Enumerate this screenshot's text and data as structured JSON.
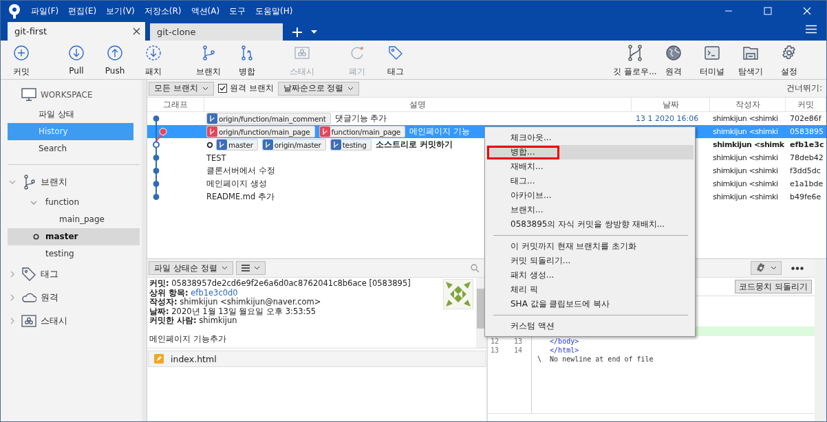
{
  "window": {
    "menu": [
      "파일(F)",
      "편집(E)",
      "보기(V)",
      "저장소(R)",
      "액션(A)",
      "도구",
      "도움말(H)"
    ]
  },
  "tabs": [
    {
      "label": "git-first",
      "selected": true
    },
    {
      "label": "git-clone",
      "selected": false
    }
  ],
  "toolbar": {
    "left_groups": [
      [
        {
          "label": "커밋",
          "kind": "commit",
          "disabled": false
        }
      ],
      [
        {
          "label": "Pull",
          "kind": "pull",
          "disabled": false
        },
        {
          "label": "Push",
          "kind": "push",
          "disabled": false
        },
        {
          "label": "패치",
          "kind": "fetch",
          "disabled": false
        }
      ],
      [
        {
          "label": "브랜치",
          "kind": "branch",
          "disabled": false
        },
        {
          "label": "병합",
          "kind": "merge",
          "disabled": false
        }
      ],
      [
        {
          "label": "스태시",
          "kind": "stash",
          "disabled": true
        }
      ],
      [
        {
          "label": "폐기",
          "kind": "discard",
          "disabled": true
        },
        {
          "label": "태그",
          "kind": "tag",
          "disabled": false
        }
      ]
    ],
    "right": [
      {
        "label": "깃 플로우...",
        "kind": "flow",
        "disabled": false
      },
      {
        "label": "원격",
        "kind": "globe",
        "disabled": false
      },
      {
        "label": "터미널",
        "kind": "terminal",
        "disabled": false
      },
      {
        "label": "탐색기",
        "kind": "folder",
        "disabled": false
      },
      {
        "label": "설정",
        "kind": "gear",
        "disabled": false
      }
    ]
  },
  "sidebar": {
    "workspace": {
      "title": "WORKSPACE",
      "items": [
        {
          "label": "파일 상태",
          "selected": false
        },
        {
          "label": "History",
          "selected": true
        },
        {
          "label": "Search",
          "selected": false
        }
      ]
    },
    "sections": [
      {
        "label": "브랜치",
        "kind": "branch",
        "expanded": true,
        "children": [
          {
            "label": "function",
            "expanded": true,
            "children": [
              {
                "label": "main_page",
                "current": false
              }
            ]
          },
          {
            "label": "master",
            "current": true
          },
          {
            "label": "testing",
            "current": false
          }
        ]
      },
      {
        "label": "태그",
        "kind": "tag",
        "expanded": false
      },
      {
        "label": "원격",
        "kind": "cloud",
        "expanded": false
      },
      {
        "label": "스태시",
        "kind": "stash",
        "expanded": false
      }
    ]
  },
  "filter_bar": {
    "branch_filter": "모든 브랜치",
    "remote_branches": {
      "label": "원격 브랜치",
      "checked": true
    },
    "sort": "날짜순으로 정렬",
    "skip_label": "건너뛰기:"
  },
  "history": {
    "columns": [
      "그래프",
      "설명",
      "날짜",
      "작성자",
      "커밋"
    ],
    "rows": [
      {
        "kind": "main",
        "selected": false,
        "current": false,
        "refs": [
          {
            "label": "origin/function/main_comment",
            "color": "#3b6fb6"
          }
        ],
        "description": "댓글기능 추가",
        "date": "13 1 2020 16:06",
        "author": "shimkijun <shimki",
        "commit": "702e86f"
      },
      {
        "kind": "side",
        "selected": true,
        "current": false,
        "refs": [
          {
            "label": "origin/function/main_page",
            "color": "#e8455a"
          },
          {
            "label": "function/main_page",
            "color": "#e8455a"
          }
        ],
        "description": "메인페이지 기능",
        "author": "shimkijun <shimki",
        "commit": "0583895"
      },
      {
        "kind": "main",
        "selected": false,
        "current": true,
        "refs": [
          {
            "label": "master",
            "color": "#3b6fb6"
          },
          {
            "label": "origin/master",
            "color": "#3b6fb6"
          },
          {
            "label": "testing",
            "color": "#3b6fb6"
          }
        ],
        "description": "소스트리로 커밋하기",
        "author": "shimkijun <shimk",
        "commit": "efb1e3c"
      },
      {
        "kind": "main",
        "selected": false,
        "current": false,
        "refs": [],
        "description": "TEST",
        "author": "shimkijun <shimki",
        "commit": "78deb42"
      },
      {
        "kind": "main",
        "selected": false,
        "current": false,
        "refs": [],
        "description": "클론서버에서 수정",
        "author": "shimkijun <shimki",
        "commit": "f3dd5dc"
      },
      {
        "kind": "main",
        "selected": false,
        "current": false,
        "refs": [],
        "description": "메인페이지 생성",
        "author": "shimkijun <shimki",
        "commit": "e1a1bde"
      },
      {
        "kind": "main",
        "selected": false,
        "current": false,
        "refs": [],
        "description": "README.md 추가",
        "author": "shimkijun <shimki",
        "commit": "b49fe6e"
      }
    ]
  },
  "commit_details": {
    "sort": "파일 상태순 정렬",
    "fields": [
      {
        "label": "커밋:",
        "value": "05838957de2cd6e9f2e6a6d0ac8762041c8b6ace [0583895]",
        "link": false
      },
      {
        "label": "상위 항목:",
        "value": "efb1e3c0d0",
        "link": true
      },
      {
        "label": "작성자:",
        "value": "shimkijun <shimkijun@naver.com>",
        "link": false
      },
      {
        "label": "날짜:",
        "value": "2020년 1월 13일 월요일 오후 3:53:55",
        "link": false
      },
      {
        "label": "커밋한 사람:",
        "value": "shimkijun",
        "link": false
      }
    ],
    "message": "메인페이지 기능추가",
    "files": [
      {
        "name": "index.html",
        "kind": "modified"
      }
    ]
  },
  "diff": {
    "discard_hunk": "코드뭉치 되돌리기",
    "lines": [
      {
        "kind": "added"
      },
      {
        "kind": "context",
        "old": "12",
        "new": "13",
        "code": "    </body>"
      },
      {
        "kind": "context",
        "old": "13",
        "new": "14",
        "code": "    </html>"
      },
      {
        "kind": "note",
        "code": " \\  No newline at end of file"
      }
    ]
  },
  "context_menu": {
    "groups": [
      {
        "items": [
          {
            "label": "체크아웃...",
            "hovered": false,
            "marked": false
          },
          {
            "label": "병합...",
            "hovered": true,
            "marked": true
          },
          {
            "label": "재배치...",
            "hovered": false,
            "marked": false
          },
          {
            "label": "태그...",
            "hovered": false,
            "marked": false
          },
          {
            "label": "아카이브...",
            "hovered": false,
            "marked": false
          },
          {
            "label": "브랜치...",
            "hovered": false,
            "marked": false
          },
          {
            "label": "0583895의 자식 커밋을 쌍방향 재배치...",
            "hovered": false,
            "marked": false
          }
        ]
      },
      {
        "items": [
          {
            "label": "이 커밋까지 현재 브랜치를 초기화",
            "hovered": false,
            "marked": false
          },
          {
            "label": "커밋 되돌리기...",
            "hovered": false,
            "marked": false
          },
          {
            "label": "패치 생성...",
            "hovered": false,
            "marked": false
          },
          {
            "label": "체리 픽",
            "hovered": false,
            "marked": false
          },
          {
            "label": "SHA 값을 클립보드에 복사",
            "hovered": false,
            "marked": false
          }
        ]
      },
      {
        "items": [
          {
            "label": "커스텀 액션",
            "hovered": false,
            "marked": false
          }
        ]
      }
    ]
  }
}
